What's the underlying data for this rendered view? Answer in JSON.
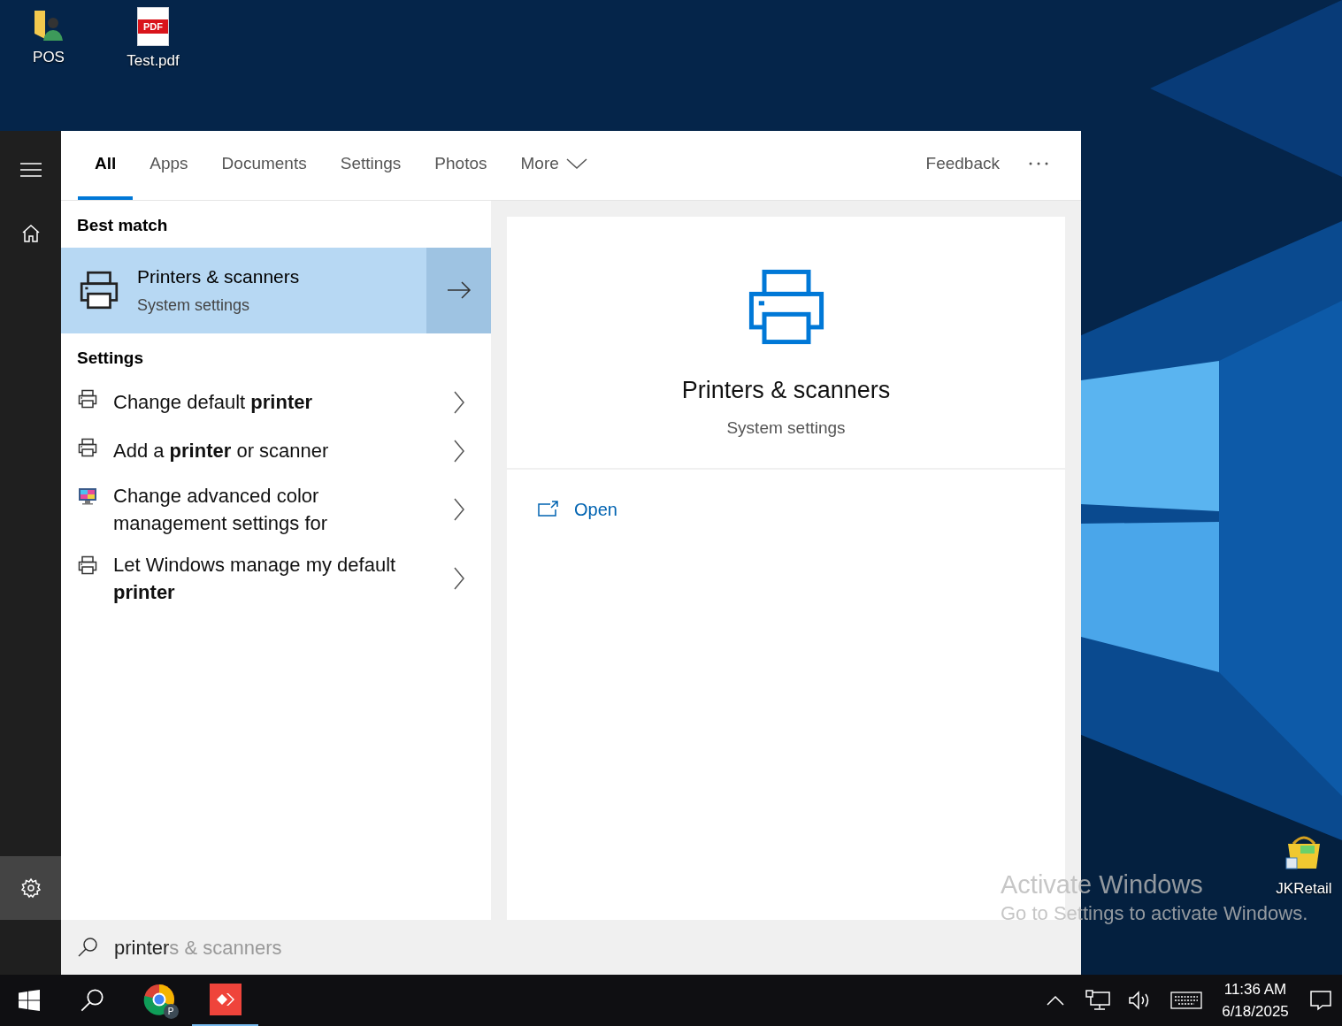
{
  "desktop": {
    "icons": [
      {
        "label": "POS",
        "kind": "folder"
      },
      {
        "label": "Test.pdf",
        "kind": "pdf",
        "badge": "PDF"
      },
      {
        "label": "JKRetail",
        "kind": "app"
      }
    ]
  },
  "search_panel": {
    "tabs": [
      {
        "label": "All",
        "selected": true
      },
      {
        "label": "Apps",
        "selected": false
      },
      {
        "label": "Documents",
        "selected": false
      },
      {
        "label": "Settings",
        "selected": false
      },
      {
        "label": "Photos",
        "selected": false
      },
      {
        "label": "More",
        "selected": false,
        "kind": "dropdown"
      }
    ],
    "feedback": "Feedback",
    "best_match": {
      "heading": "Best match",
      "title": "Printers & scanners",
      "subtitle": "System settings",
      "selected": true
    },
    "settings": {
      "heading": "Settings",
      "items": [
        {
          "text": "Change default **printer**",
          "kind": "printer"
        },
        {
          "text": "Add a **printer** or scanner",
          "kind": "printer"
        },
        {
          "text": "Change advanced color management settings for",
          "kind": "display"
        },
        {
          "text": "Let Windows manage my default **printer**",
          "kind": "printer"
        }
      ]
    },
    "preview": {
      "title": "Printers & scanners",
      "subtitle": "System settings",
      "actions": [
        {
          "label": "Open"
        }
      ]
    },
    "search": {
      "value": "printer",
      "suggestion": "s & scanners"
    }
  },
  "activation_notice": {
    "title": "Activate Windows",
    "text": "Go to Settings to activate Windows."
  },
  "taskbar": {
    "apps": [
      {
        "kind": "chrome",
        "badge": "P",
        "running": false
      },
      {
        "kind": "anydesk",
        "running": true
      }
    ],
    "time": "11:36 AM",
    "date": "6/18/2025"
  }
}
